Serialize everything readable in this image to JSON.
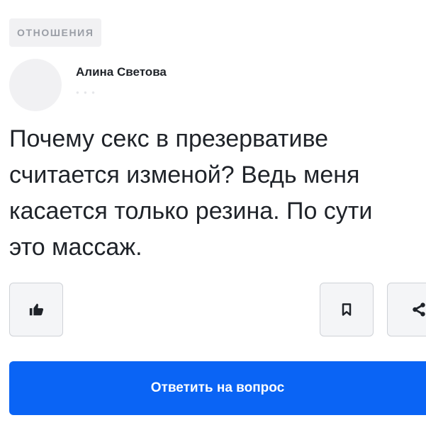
{
  "category": {
    "label": "ОТНОШЕНИЯ"
  },
  "author": {
    "name": "Алина Светова"
  },
  "question": {
    "text": "Почему секс в презервативе\nсчитается изменой? Ведь меня\nкасается только резина. По сути\nэто массаж."
  },
  "actions": {
    "like_icon": "thumbs-up-icon",
    "bookmark_icon": "bookmark-icon",
    "share_icon": "share-icon",
    "answer_label": "Ответить на вопрос"
  },
  "colors": {
    "primary": "#0a64f5",
    "badge_bg": "#f1f1f3",
    "text": "#1f2329"
  }
}
